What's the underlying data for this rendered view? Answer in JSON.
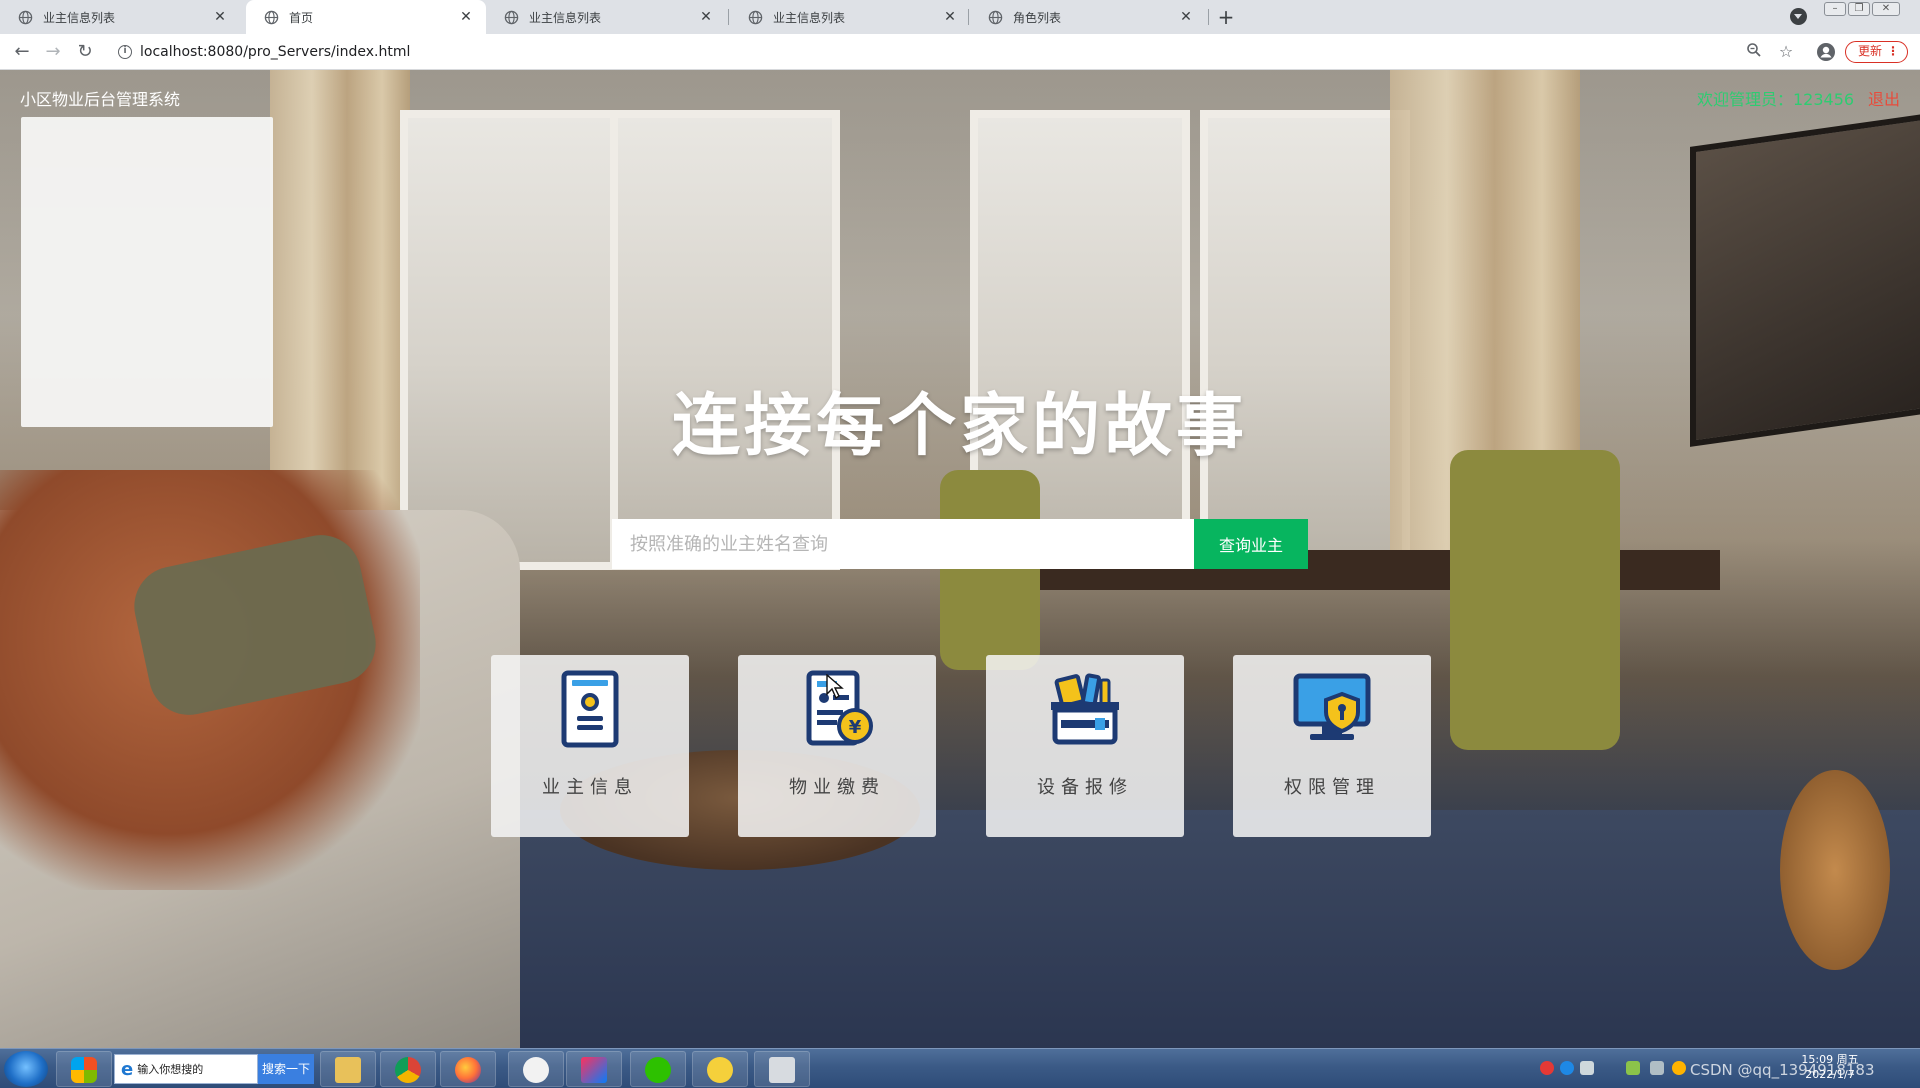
{
  "browser": {
    "tabs": [
      {
        "title": "业主信息列表",
        "active": false
      },
      {
        "title": "首页",
        "active": true
      },
      {
        "title": "业主信息列表",
        "active": false
      },
      {
        "title": "业主信息列表",
        "active": false
      },
      {
        "title": "角色列表",
        "active": false
      }
    ],
    "url": "localhost:8080/pro_Servers/index.html",
    "update_label": "更新",
    "new_tab": "+"
  },
  "header": {
    "site_title": "小区物业后台管理系统",
    "welcome": "欢迎管理员：123456",
    "logout": "退出"
  },
  "hero": {
    "title": "连接每个家的故事"
  },
  "search": {
    "placeholder": "按照准确的业主姓名查询",
    "button": "查询业主"
  },
  "cards": [
    {
      "label": "业主信息",
      "icon": "owner-profile-icon"
    },
    {
      "label": "物业缴费",
      "icon": "payment-bill-icon"
    },
    {
      "label": "设备报修",
      "icon": "repair-toolbox-icon"
    },
    {
      "label": "权限管理",
      "icon": "permission-lock-icon"
    }
  ],
  "taskbar": {
    "ie_search_placeholder": "输入你想搜的",
    "ie_search_button": "搜索一下",
    "clock_time": "15:09 周五",
    "clock_date": "2022/1/7",
    "watermark": "CSDN @qq_1394918183"
  },
  "colors": {
    "accent_green": "#07b55f",
    "welcome_green": "#2ecc71",
    "logout_red": "#e74c3c",
    "icon_navy": "#1d3a73",
    "icon_yellow": "#f4c21b",
    "icon_blue": "#3aa0e6"
  }
}
